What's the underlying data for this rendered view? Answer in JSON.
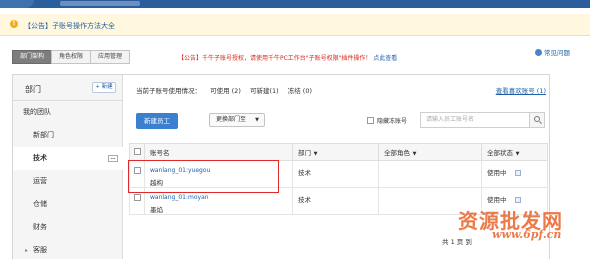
{
  "notice": {
    "text": "【公告】子账号操作方法大全"
  },
  "tabs": [
    {
      "label": "部门架构"
    },
    {
      "label": "角色权限"
    },
    {
      "label": "应用管理"
    }
  ],
  "announcement": {
    "text": "【公告】千牛子账号授权，请使用千牛PC工作台\"子账号权限\"插件操作！",
    "link": "点此查看"
  },
  "help": {
    "label": "常见问题"
  },
  "sidebar": {
    "title": "部门",
    "new_label": "+ 新建",
    "items": [
      {
        "label": "我的团队"
      },
      {
        "label": "新部门"
      },
      {
        "label": "技术",
        "more": "…"
      },
      {
        "label": "运营"
      },
      {
        "label": "仓储"
      },
      {
        "label": "财务"
      },
      {
        "label": "客服",
        "caret": "▸"
      }
    ]
  },
  "usage": {
    "label": "当前子账号使用情况：",
    "in_use": "可使用 (2)",
    "creatable": "可新建(1)",
    "frozen": "冻结 (0)"
  },
  "view_link": "查看喜欢账号 (1)",
  "toolbar": {
    "new_employee": "新建员工",
    "move_dept": "更换部门至",
    "hide_frozen": "隐藏冻账号",
    "search_placeholder": "请输入员工账号名"
  },
  "table": {
    "headers": {
      "account": "账号名",
      "dept": "部门",
      "role": "全部角色",
      "status": "全部状态"
    },
    "rows": [
      {
        "account": "wanlang_01:yuegou",
        "name": "越构",
        "dept": "技术",
        "role": "",
        "status": "使用中"
      },
      {
        "account": "wanlang_01:moyan",
        "name": "墨焰",
        "dept": "技术",
        "role": "",
        "status": "使用中"
      }
    ]
  },
  "pager": "共 1 页 到",
  "watermark": {
    "line1": "资源批发网",
    "line2": "www.6pf.cn"
  },
  "colors": {
    "accent": "#3a7fd0",
    "link": "#1f5fa8",
    "alert": "#d9261c",
    "highlight_box": "#e0292b"
  }
}
